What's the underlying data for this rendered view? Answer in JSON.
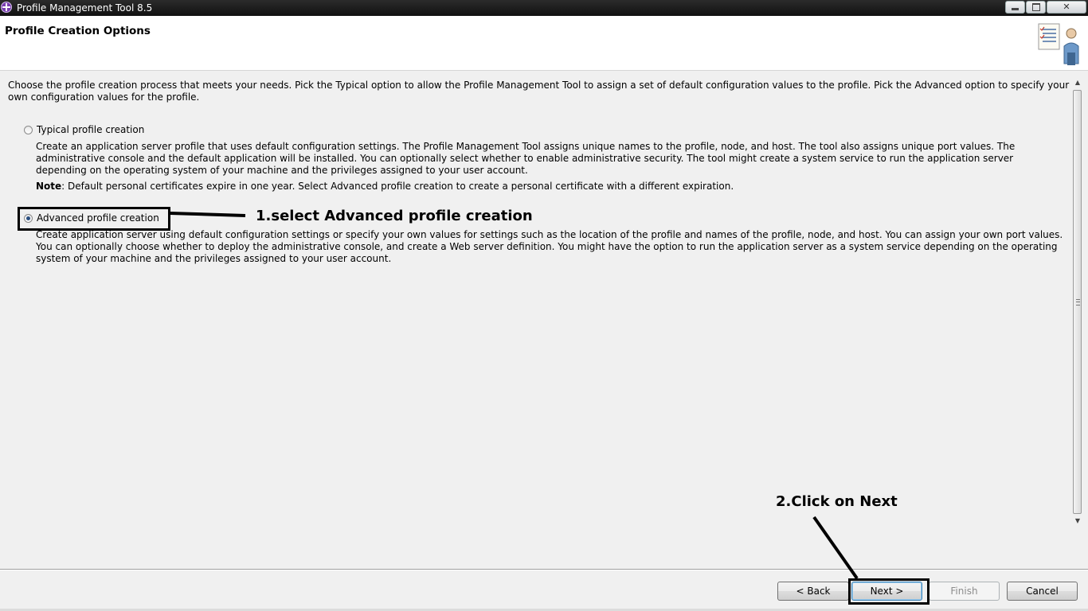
{
  "window": {
    "title": "Profile Management Tool 8.5",
    "controls": {
      "minimize": "",
      "maximize": "",
      "close": "✕"
    }
  },
  "header": {
    "title": "Profile Creation Options",
    "icon": "wizard-checklist-person-icon"
  },
  "content": {
    "intro": "Choose the profile creation process that meets your needs. Pick the Typical option to allow the Profile Management Tool to assign a set of default configuration values to the profile. Pick the Advanced option to specify your own configuration values for the profile.",
    "options": [
      {
        "label": "Typical profile creation",
        "selected": false,
        "description": "Create an application server profile that uses default configuration settings. The Profile Management Tool assigns unique names to the profile, node, and host. The tool also assigns unique port values. The administrative console and the default application will be installed. You can optionally select whether to enable administrative security. The tool might create a system service to run the application server depending on the operating system of your machine and the privileges assigned to your user account.",
        "note_label": "Note",
        "note_text": ": Default personal certificates expire in one year.  Select Advanced profile creation to create a personal certificate with a different expiration."
      },
      {
        "label": "Advanced profile creation",
        "selected": true,
        "description": "Create application server using default configuration settings or specify your own values for settings such as the location of the profile and names of the profile, node, and host. You can assign your own port values. You can optionally choose whether to deploy the administrative console, and create a Web server definition. You might have the option to run the application server as a system service depending on the operating system of your machine and the privileges assigned to your user account."
      }
    ]
  },
  "buttons": {
    "back": "< Back",
    "next": "Next >",
    "finish": "Finish",
    "cancel": "Cancel"
  },
  "annotations": {
    "step1": "1.select Advanced profile creation",
    "step2": "2.Click on Next"
  },
  "scrollbar": {
    "up_arrow": "▲",
    "down_arrow": "▼"
  }
}
